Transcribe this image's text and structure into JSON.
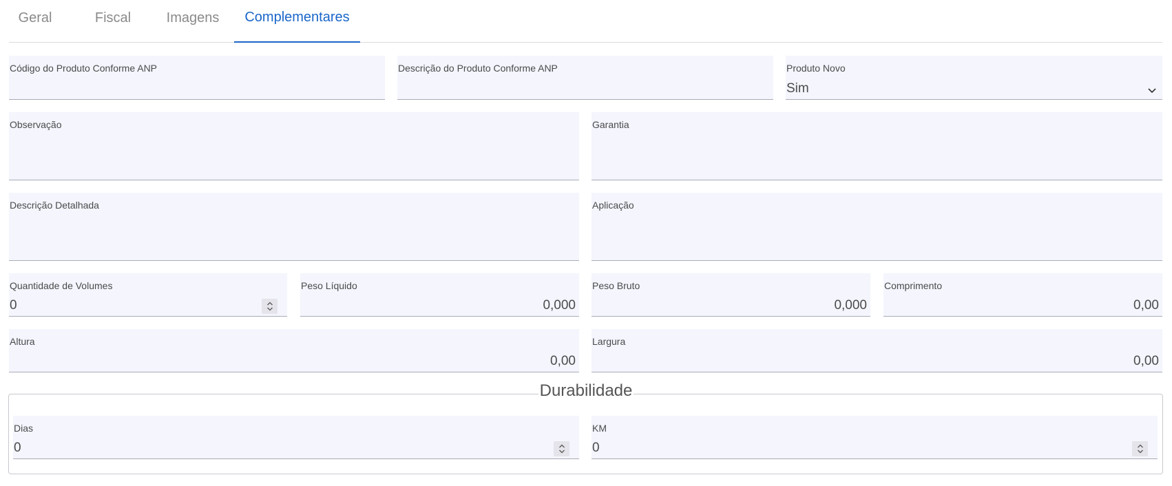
{
  "tabs": [
    {
      "label": "Geral"
    },
    {
      "label": "Fiscal"
    },
    {
      "label": "Imagens"
    },
    {
      "label": "Complementares"
    }
  ],
  "form": {
    "codigo_anp": {
      "label": "Código do Produto Conforme ANP",
      "value": ""
    },
    "descricao_anp": {
      "label": "Descrição do Produto Conforme ANP",
      "value": ""
    },
    "produto_novo": {
      "label": "Produto Novo",
      "value": "Sim"
    },
    "observacao": {
      "label": "Observação",
      "value": ""
    },
    "garantia": {
      "label": "Garantia",
      "value": ""
    },
    "descricao_detalhada": {
      "label": "Descrição Detalhada",
      "value": ""
    },
    "aplicacao": {
      "label": "Aplicação",
      "value": ""
    },
    "quantidade_volumes": {
      "label": "Quantidade de Volumes",
      "value": "0"
    },
    "peso_liquido": {
      "label": "Peso Líquido",
      "value": "0,000"
    },
    "peso_bruto": {
      "label": "Peso Bruto",
      "value": "0,000"
    },
    "comprimento": {
      "label": "Comprimento",
      "value": "0,00"
    },
    "altura": {
      "label": "Altura",
      "value": "0,00"
    },
    "largura": {
      "label": "Largura",
      "value": "0,00"
    }
  },
  "durabilidade": {
    "legend": "Durabilidade",
    "dias": {
      "label": "Dias",
      "value": "0"
    },
    "km": {
      "label": "KM",
      "value": "0"
    }
  },
  "colors": {
    "accent": "#1a66c9",
    "field_bg": "#f4f5fd",
    "tab_inactive": "#8a8a8a"
  },
  "icons": {
    "select_arrow": "chevron-down-icon",
    "number_spinner": "spinner-arrows-icon"
  }
}
